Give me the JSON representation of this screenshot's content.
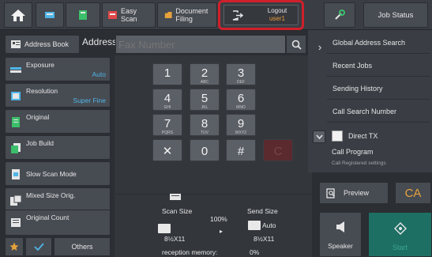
{
  "topbar": {
    "tabs": [
      {
        "label": ""
      },
      {
        "label": ""
      },
      {
        "label": "Easy Scan"
      },
      {
        "label": "Document Filing"
      }
    ],
    "logout": {
      "label": "Logout",
      "user": "user1"
    },
    "job_status": "Job Status"
  },
  "address": {
    "book_label": "Address Book",
    "label": "Address",
    "placeholder": "Fax Number"
  },
  "settings": [
    {
      "label": "Exposure",
      "value": "Auto"
    },
    {
      "label": "Resolution",
      "value": "Super Fine"
    },
    {
      "label": "Original",
      "value": ""
    },
    {
      "label": "Job Build",
      "value": ""
    },
    {
      "label": "Slow Scan Mode",
      "value": ""
    },
    {
      "label": "Mixed Size Orig.",
      "value": ""
    },
    {
      "label": "Original Count",
      "value": ""
    }
  ],
  "bottom_left": {
    "others": "Others"
  },
  "keypad": {
    "keys": [
      {
        "num": "1",
        "sub": ""
      },
      {
        "num": "2",
        "sub": "ABC"
      },
      {
        "num": "3",
        "sub": "DEF"
      },
      {
        "num": "4",
        "sub": "GHI"
      },
      {
        "num": "5",
        "sub": "JKL"
      },
      {
        "num": "6",
        "sub": "MNO"
      },
      {
        "num": "7",
        "sub": "PQRS"
      },
      {
        "num": "8",
        "sub": "TUV"
      },
      {
        "num": "9",
        "sub": "WXYZ"
      },
      {
        "num": "✕",
        "sub": ""
      },
      {
        "num": "0",
        "sub": ""
      },
      {
        "num": "#",
        "sub": ""
      },
      {
        "num": "C",
        "sub": ""
      }
    ]
  },
  "scan": {
    "scan_size_label": "Scan Size",
    "send_size_label": "Send Size",
    "ratio": "100%",
    "send_auto": "Auto",
    "scan_paper": "8½X11",
    "send_paper": "8½X11",
    "memory_label": "reception memory:",
    "memory_value": "0%"
  },
  "right_panel": {
    "items": [
      {
        "label": "Global Address Search"
      },
      {
        "label": "Recent Jobs"
      },
      {
        "label": "Sending History"
      },
      {
        "label": "Call Search Number"
      }
    ],
    "direct_tx": "Direct TX",
    "call_program": "Call Program",
    "call_registered": "Call Registered settings"
  },
  "actions": {
    "preview": "Preview",
    "ca": "CA",
    "speaker": "Speaker",
    "start": "Start"
  },
  "colors": {
    "accent_blue": "#4fb5e6",
    "accent_orange": "#e6a23c",
    "logout_highlight": "#d0202a",
    "start_green": "#1d6f64"
  }
}
